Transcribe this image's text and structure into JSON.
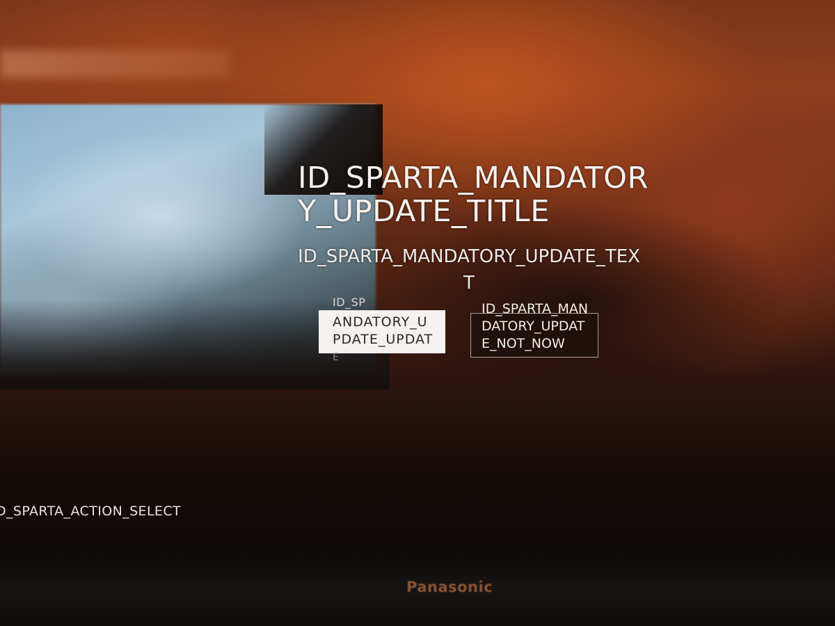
{
  "dialog": {
    "title": "ID_SPARTA_MANDATORY_UPDATE_TITLE",
    "text": "ID_SPARTA_MANDATORY_UPDATE_TEXT",
    "update_button": {
      "label_top": "ID_SP",
      "label": "ANDATORY_UPDATE_UPDAT",
      "label_bottom": "E"
    },
    "not_now_button": {
      "label": "ID_SPARTA_MANDATORY_UPDATE_NOT_NOW"
    }
  },
  "footer": {
    "action_hint": "D_SPARTA_ACTION_SELECT"
  },
  "bezel": {
    "brand": "Panasonic"
  },
  "colors": {
    "background_orange": "#8f3f1c",
    "selected_button_bg": "#f4f2f0",
    "text": "#f6f2ee"
  }
}
